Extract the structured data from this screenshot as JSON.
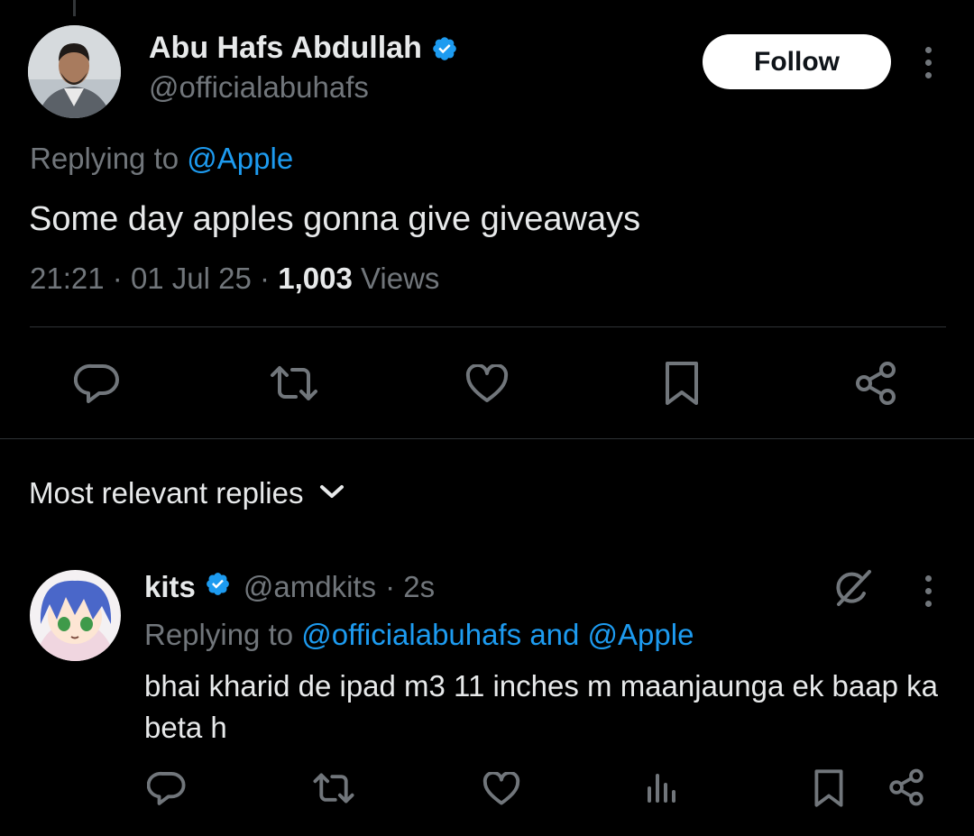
{
  "tweet": {
    "author_name": "Abu Hafs Abdullah",
    "author_handle": "@officialabuhafs",
    "follow_label": "Follow",
    "replying_prefix": "Replying to",
    "replying_to": "@Apple",
    "text": "Some day apples gonna give giveaways",
    "time": "21:21",
    "date": "01 Jul 25",
    "views_count": "1,003",
    "views_label": "Views",
    "separator": "·"
  },
  "sort": {
    "label": "Most relevant replies"
  },
  "reply": {
    "author_name": "kits",
    "author_handle": "@amdkits",
    "age": "· 2s",
    "replying_prefix": "Replying to",
    "replying_to": "@officialabuhafs and @Apple",
    "text": "bhai kharid de ipad m3 11 inches m maanjaunga ek baap ka beta h"
  },
  "colors": {
    "background": "#000000",
    "text": "#e7e9ea",
    "muted": "#71767b",
    "link": "#1d9bf0",
    "verified": "#1d9bf0"
  },
  "icons": [
    "reply-icon",
    "retweet-icon",
    "like-icon",
    "bookmark-icon",
    "share-icon",
    "views-icon",
    "grok-icon",
    "more-icon",
    "chevron-down-icon",
    "verified-badge-icon"
  ]
}
